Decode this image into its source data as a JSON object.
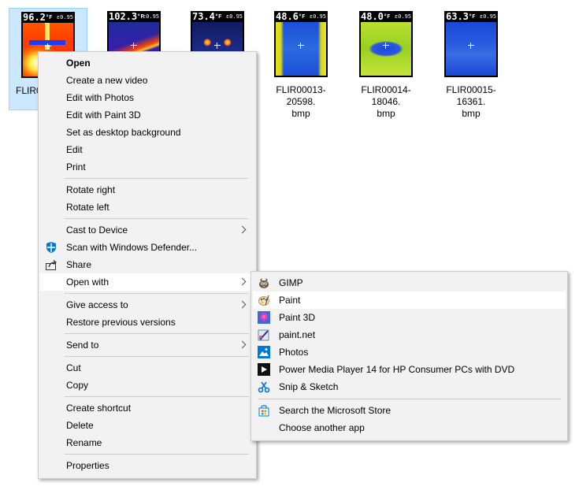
{
  "files": [
    {
      "temp": "96.2",
      "name": "FLIR0"
    },
    {
      "temp": "102.3",
      "name": ""
    },
    {
      "temp": "73.4",
      "name": ""
    },
    {
      "temp": "48.6",
      "name": "FLIR00013-20598.\nbmp"
    },
    {
      "temp": "48.0",
      "name": "FLIR00014-18046.\nbmp"
    },
    {
      "temp": "63.3",
      "name": "FLIR00015-16361.\nbmp"
    }
  ],
  "thumb_header_suffix": "°F",
  "thumb_emissivity": "ε0.95",
  "context_menu": {
    "items": {
      "open": "Open",
      "create_video": "Create a new video",
      "edit_photos": "Edit with Photos",
      "edit_paint3d": "Edit with Paint 3D",
      "set_desktop": "Set as desktop background",
      "edit": "Edit",
      "print": "Print",
      "rotate_right": "Rotate right",
      "rotate_left": "Rotate left",
      "cast": "Cast to Device",
      "scan": "Scan with Windows Defender...",
      "share": "Share",
      "open_with": "Open with",
      "give_access": "Give access to",
      "restore": "Restore previous versions",
      "send_to": "Send to",
      "cut": "Cut",
      "copy": "Copy",
      "create_shortcut": "Create shortcut",
      "delete": "Delete",
      "rename": "Rename",
      "properties": "Properties"
    }
  },
  "open_with_menu": {
    "items": {
      "gimp": "GIMP",
      "paint": "Paint",
      "paint3d": "Paint 3D",
      "paintnet": "paint.net",
      "photos": "Photos",
      "power_media": "Power Media Player 14 for HP Consumer PCs with DVD",
      "snip": "Snip & Sketch",
      "store": "Search the Microsoft Store",
      "another": "Choose another app"
    }
  },
  "icons": {
    "defender": "shield-icon",
    "share": "share-icon",
    "gimp": "gimp-icon",
    "paint": "paint-palette-icon",
    "paint3d": "paint3d-icon",
    "paintnet": "paintnet-icon",
    "photos": "photos-icon",
    "power_media": "power-media-icon",
    "snip": "snip-sketch-icon",
    "store": "store-icon"
  },
  "colors": {
    "selection_bg": "#cce8ff",
    "selection_border": "#99d1ff",
    "menu_bg": "#f2f2f2",
    "menu_hover": "#ffffff",
    "defender_blue": "#0078d7"
  }
}
